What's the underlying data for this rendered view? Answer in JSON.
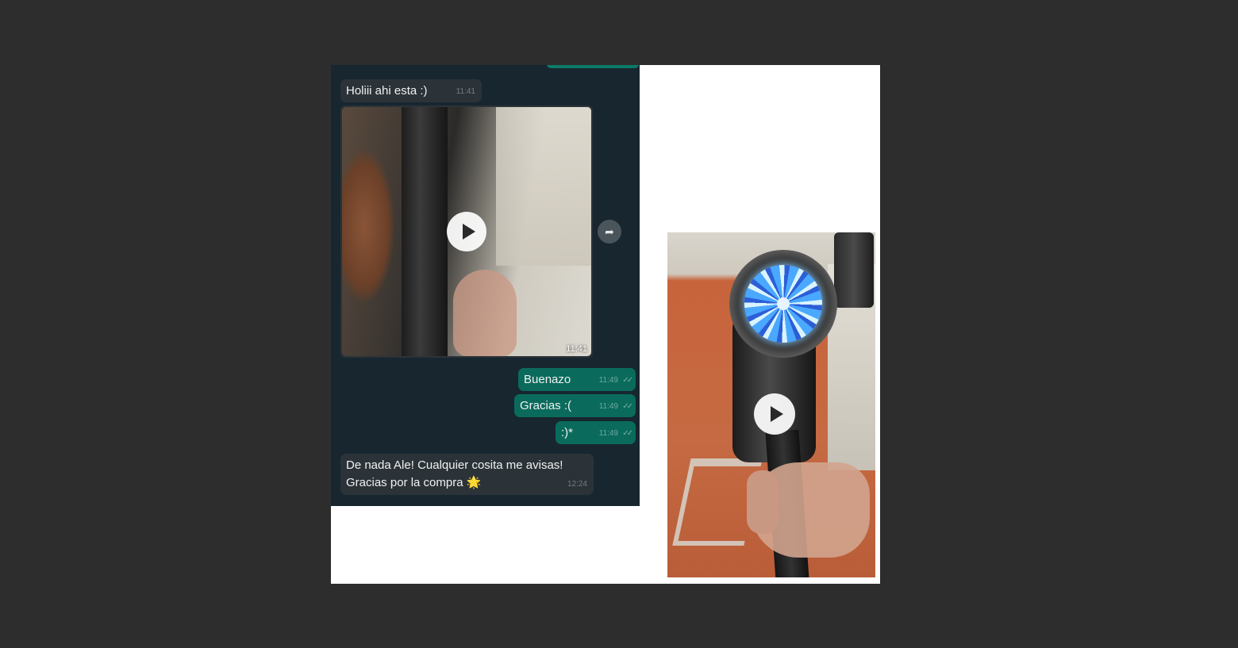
{
  "chat": {
    "messages": [
      {
        "direction": "incoming",
        "text": "Holiii ahi esta :)",
        "time": "11:41"
      },
      {
        "direction": "incoming",
        "type": "video",
        "time": "11:41",
        "icon": "play-icon"
      },
      {
        "direction": "outgoing",
        "text": "Buenazo",
        "time": "11:49",
        "status_icon": "double-check-icon"
      },
      {
        "direction": "outgoing",
        "text": "Gracias :(",
        "time": "11:49",
        "status_icon": "double-check-icon"
      },
      {
        "direction": "outgoing",
        "text": ":)*",
        "time": "11:49",
        "status_icon": "double-check-icon"
      },
      {
        "direction": "incoming",
        "text_line1": "De nada Ale! Cualquier cosita me avisas!",
        "text_line2": "Gracias por la compra 🌟",
        "time": "12:24"
      }
    ],
    "forward_icon": "forward-icon",
    "colors": {
      "chat_background": "#17262f",
      "incoming_bubble": "#2b3338",
      "outgoing_bubble": "#0a6b5c"
    }
  },
  "right_video": {
    "icon": "play-icon"
  }
}
